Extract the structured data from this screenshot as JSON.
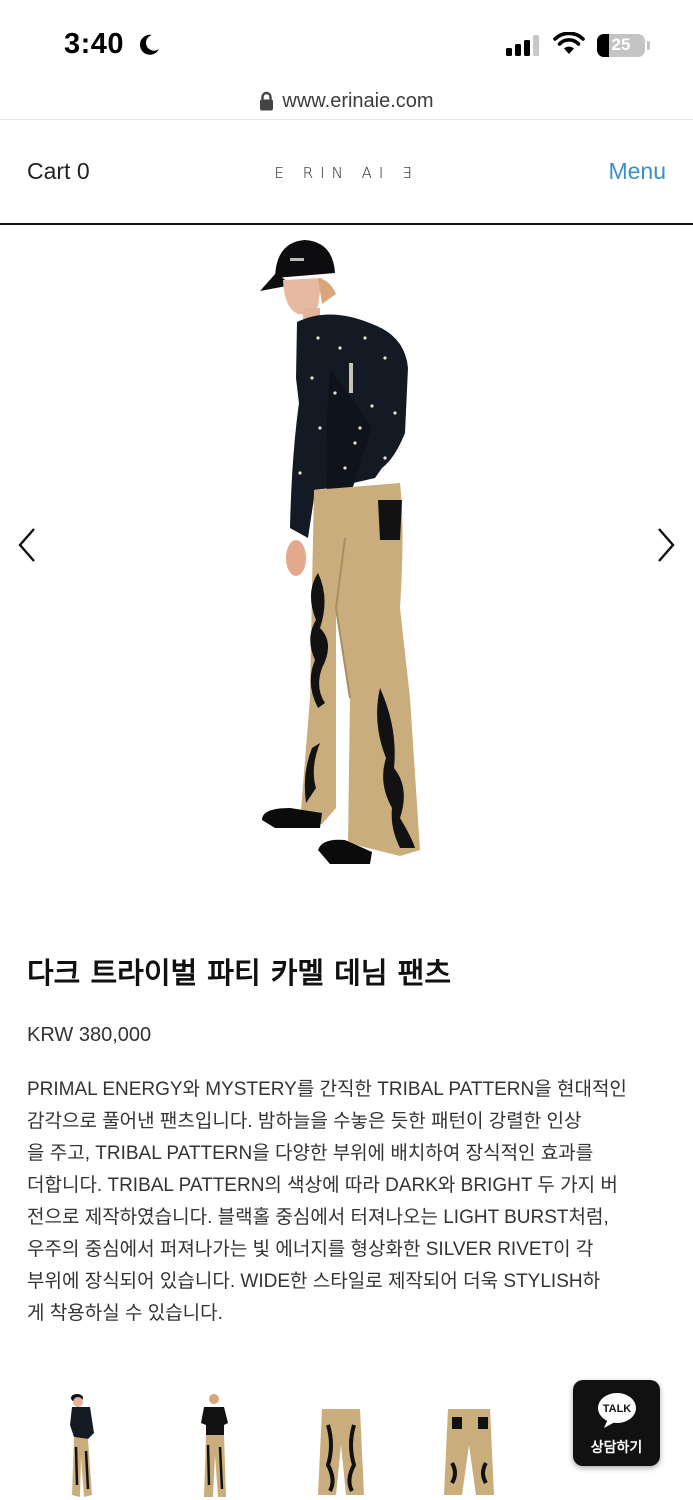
{
  "status_bar": {
    "time": "3:40",
    "battery_level": "25",
    "battery_fraction": 0.25,
    "signal_bars_active": 3,
    "signal_bars_total": 4,
    "icons": [
      "moon-icon",
      "cellular-signal-icon",
      "wifi-icon",
      "battery-icon"
    ]
  },
  "browser": {
    "url": "www.erinaie.com",
    "lock_icon": "lock-icon"
  },
  "header": {
    "cart_label": "Cart",
    "cart_count": "0",
    "brand": "E RIN AI Ǝ",
    "menu_label": "Menu"
  },
  "gallery": {
    "prev_icon": "chevron-left-icon",
    "next_icon": "chevron-right-icon",
    "thumbnail_count": 4
  },
  "product": {
    "title": "다크 트라이벌 파티 카멜 데님 팬츠",
    "price": "KRW 380,000",
    "description_lines": [
      "PRIMAL ENERGY와 MYSTERY를 간직한 TRIBAL PATTERN을 현대적인",
      "감각으로 풀어낸 팬츠입니다. 밤하늘을 수놓은 듯한 패턴이 강렬한 인상",
      "을 주고, TRIBAL PATTERN을 다양한 부위에 배치하여 장식적인 효과를",
      "더합니다. TRIBAL PATTERN의 색상에 따라 DARK와 BRIGHT 두 가지 버",
      "전으로 제작하였습니다. 블랙홀 중심에서 터져나오는 LIGHT BURST처럼,",
      "우주의 중심에서 퍼져나가는 빛 에너지를 형상화한 SILVER RIVET이 각",
      "부위에 장식되어 있습니다. WIDE한 스타일로 제작되어 더욱 STYLISH하",
      "게 착용하실 수 있습니다."
    ]
  },
  "chat_button": {
    "bubble_text": "TALK",
    "label": "상담하기"
  },
  "colors": {
    "menu_link": "#3a8fc8",
    "camel": "#c9ad7c",
    "jacket": "#141a24"
  }
}
